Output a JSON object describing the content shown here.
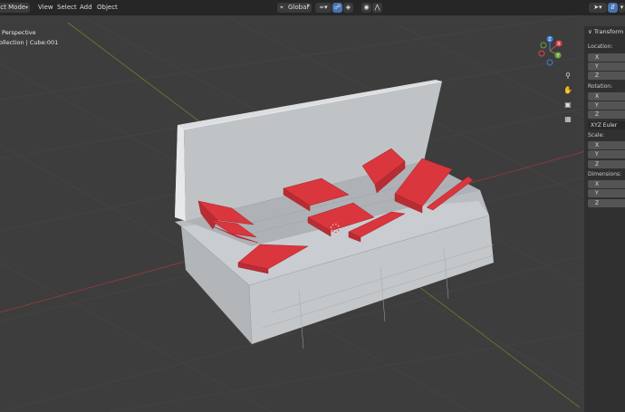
{
  "header": {
    "mode": "ect Mode",
    "menus": [
      "View",
      "Select",
      "Add",
      "Object"
    ],
    "orientation": "Global"
  },
  "viewport": {
    "view_name": "Perspective",
    "collection": "ollection | Cube:001"
  },
  "gizmo": {
    "axes": {
      "x": "X",
      "y": "Y",
      "z": "Z"
    },
    "colors": {
      "x": "#e0424f",
      "y": "#6ea33f",
      "z": "#3f7fd8"
    }
  },
  "sidebar": {
    "title": "Transform",
    "location_label": "Location:",
    "rotation_label": "Rotation:",
    "rotation_mode": "XYZ Euler",
    "scale_label": "Scale:",
    "dimensions_label": "Dimensions:",
    "axis_x": "X",
    "axis_y": "Y",
    "axis_z": "Z"
  },
  "colors": {
    "background": "#3d3d3d",
    "box": "#c4c7ca",
    "red_object": "#d9363e",
    "accent": "#4772b3"
  }
}
